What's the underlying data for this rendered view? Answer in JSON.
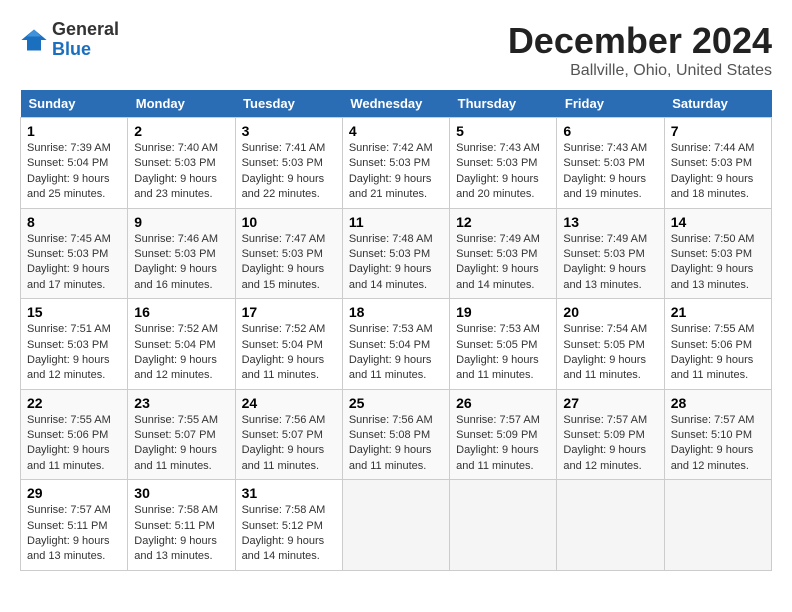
{
  "header": {
    "logo_general": "General",
    "logo_blue": "Blue",
    "title": "December 2024",
    "subtitle": "Ballville, Ohio, United States"
  },
  "days_of_week": [
    "Sunday",
    "Monday",
    "Tuesday",
    "Wednesday",
    "Thursday",
    "Friday",
    "Saturday"
  ],
  "weeks": [
    [
      {
        "day": "1",
        "sunrise": "7:39 AM",
        "sunset": "5:04 PM",
        "daylight": "9 hours and 25 minutes."
      },
      {
        "day": "2",
        "sunrise": "7:40 AM",
        "sunset": "5:03 PM",
        "daylight": "9 hours and 23 minutes."
      },
      {
        "day": "3",
        "sunrise": "7:41 AM",
        "sunset": "5:03 PM",
        "daylight": "9 hours and 22 minutes."
      },
      {
        "day": "4",
        "sunrise": "7:42 AM",
        "sunset": "5:03 PM",
        "daylight": "9 hours and 21 minutes."
      },
      {
        "day": "5",
        "sunrise": "7:43 AM",
        "sunset": "5:03 PM",
        "daylight": "9 hours and 20 minutes."
      },
      {
        "day": "6",
        "sunrise": "7:43 AM",
        "sunset": "5:03 PM",
        "daylight": "9 hours and 19 minutes."
      },
      {
        "day": "7",
        "sunrise": "7:44 AM",
        "sunset": "5:03 PM",
        "daylight": "9 hours and 18 minutes."
      }
    ],
    [
      {
        "day": "8",
        "sunrise": "7:45 AM",
        "sunset": "5:03 PM",
        "daylight": "9 hours and 17 minutes."
      },
      {
        "day": "9",
        "sunrise": "7:46 AM",
        "sunset": "5:03 PM",
        "daylight": "9 hours and 16 minutes."
      },
      {
        "day": "10",
        "sunrise": "7:47 AM",
        "sunset": "5:03 PM",
        "daylight": "9 hours and 15 minutes."
      },
      {
        "day": "11",
        "sunrise": "7:48 AM",
        "sunset": "5:03 PM",
        "daylight": "9 hours and 14 minutes."
      },
      {
        "day": "12",
        "sunrise": "7:49 AM",
        "sunset": "5:03 PM",
        "daylight": "9 hours and 14 minutes."
      },
      {
        "day": "13",
        "sunrise": "7:49 AM",
        "sunset": "5:03 PM",
        "daylight": "9 hours and 13 minutes."
      },
      {
        "day": "14",
        "sunrise": "7:50 AM",
        "sunset": "5:03 PM",
        "daylight": "9 hours and 13 minutes."
      }
    ],
    [
      {
        "day": "15",
        "sunrise": "7:51 AM",
        "sunset": "5:03 PM",
        "daylight": "9 hours and 12 minutes."
      },
      {
        "day": "16",
        "sunrise": "7:52 AM",
        "sunset": "5:04 PM",
        "daylight": "9 hours and 12 minutes."
      },
      {
        "day": "17",
        "sunrise": "7:52 AM",
        "sunset": "5:04 PM",
        "daylight": "9 hours and 11 minutes."
      },
      {
        "day": "18",
        "sunrise": "7:53 AM",
        "sunset": "5:04 PM",
        "daylight": "9 hours and 11 minutes."
      },
      {
        "day": "19",
        "sunrise": "7:53 AM",
        "sunset": "5:05 PM",
        "daylight": "9 hours and 11 minutes."
      },
      {
        "day": "20",
        "sunrise": "7:54 AM",
        "sunset": "5:05 PM",
        "daylight": "9 hours and 11 minutes."
      },
      {
        "day": "21",
        "sunrise": "7:55 AM",
        "sunset": "5:06 PM",
        "daylight": "9 hours and 11 minutes."
      }
    ],
    [
      {
        "day": "22",
        "sunrise": "7:55 AM",
        "sunset": "5:06 PM",
        "daylight": "9 hours and 11 minutes."
      },
      {
        "day": "23",
        "sunrise": "7:55 AM",
        "sunset": "5:07 PM",
        "daylight": "9 hours and 11 minutes."
      },
      {
        "day": "24",
        "sunrise": "7:56 AM",
        "sunset": "5:07 PM",
        "daylight": "9 hours and 11 minutes."
      },
      {
        "day": "25",
        "sunrise": "7:56 AM",
        "sunset": "5:08 PM",
        "daylight": "9 hours and 11 minutes."
      },
      {
        "day": "26",
        "sunrise": "7:57 AM",
        "sunset": "5:09 PM",
        "daylight": "9 hours and 11 minutes."
      },
      {
        "day": "27",
        "sunrise": "7:57 AM",
        "sunset": "5:09 PM",
        "daylight": "9 hours and 12 minutes."
      },
      {
        "day": "28",
        "sunrise": "7:57 AM",
        "sunset": "5:10 PM",
        "daylight": "9 hours and 12 minutes."
      }
    ],
    [
      {
        "day": "29",
        "sunrise": "7:57 AM",
        "sunset": "5:11 PM",
        "daylight": "9 hours and 13 minutes."
      },
      {
        "day": "30",
        "sunrise": "7:58 AM",
        "sunset": "5:11 PM",
        "daylight": "9 hours and 13 minutes."
      },
      {
        "day": "31",
        "sunrise": "7:58 AM",
        "sunset": "5:12 PM",
        "daylight": "9 hours and 14 minutes."
      },
      null,
      null,
      null,
      null
    ]
  ]
}
